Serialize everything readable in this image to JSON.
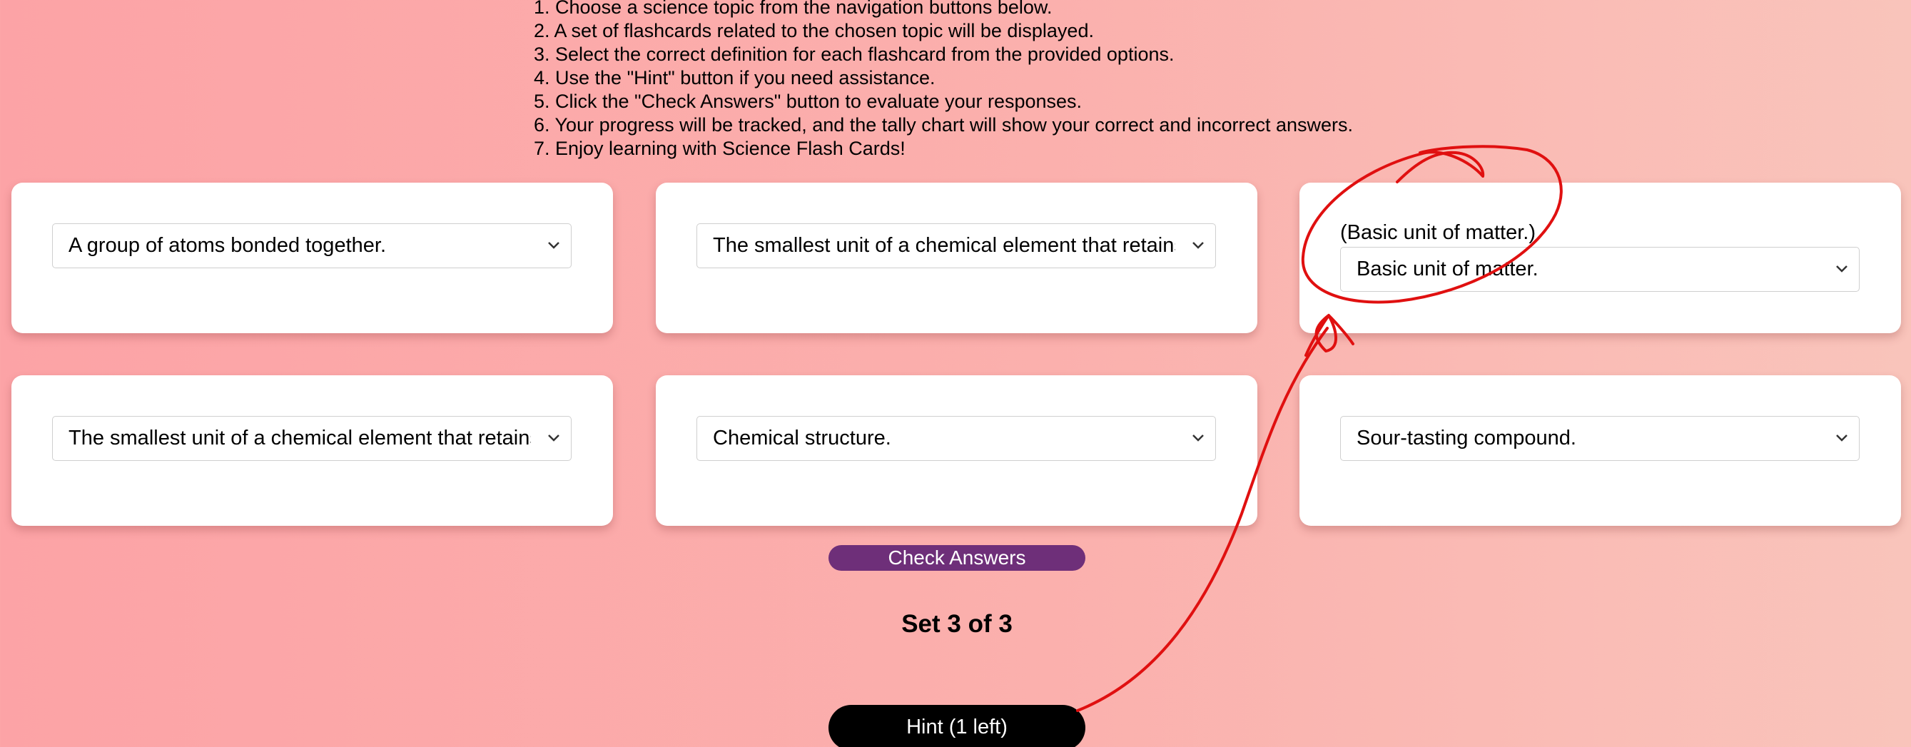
{
  "instructions": [
    "1. Choose a science topic from the navigation buttons below.",
    "2. A set of flashcards related to the chosen topic will be displayed.",
    "3. Select the correct definition for each flashcard from the provided options.",
    "4. Use the \"Hint\" button if you need assistance.",
    "5. Click the \"Check Answers\" button to evaluate your responses.",
    "6. Your progress will be tracked, and the tally chart will show your correct and incorrect answers.",
    "7. Enjoy learning with Science Flash Cards!"
  ],
  "cards": [
    {
      "selected": "A group of atoms bonded together."
    },
    {
      "selected": "The smallest unit of a chemical element that retains"
    },
    {
      "hint": "(Basic unit of matter.)",
      "selected": "Basic unit of matter."
    },
    {
      "selected": "The smallest unit of a chemical element that retains"
    },
    {
      "selected": "Chemical structure."
    },
    {
      "selected": "Sour-tasting compound."
    }
  ],
  "check_answers_label": "Check Answers",
  "set_label": "Set 3 of 3",
  "hint_button_label": "Hint (1 left)",
  "colors": {
    "check_button": "#6e2f79",
    "hint_button": "#000000",
    "annotation": "#e01010"
  },
  "icons": {
    "select_arrow": "chevron-down-icon"
  }
}
